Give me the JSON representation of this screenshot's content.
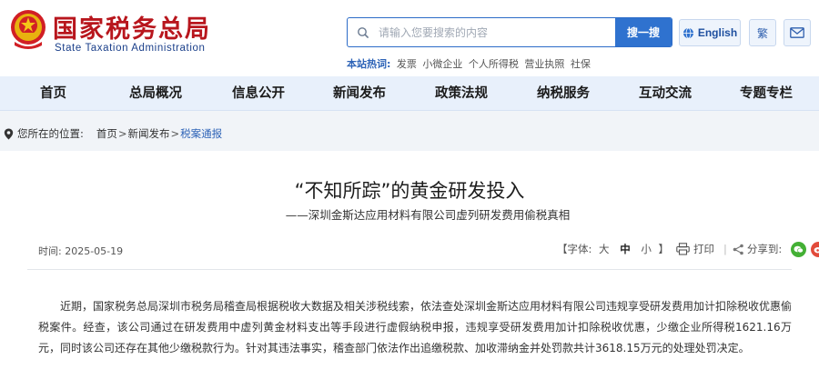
{
  "header": {
    "site_title": "国家税务总局",
    "site_subtitle": "State Taxation Administration",
    "search": {
      "placeholder": "请输入您要搜索的内容",
      "button_label": "搜一搜"
    },
    "lang_label": "English",
    "trad_label": "繁",
    "mail_icon": "mail-icon",
    "hot_search": {
      "label": "本站热词:",
      "keywords": [
        "发票",
        "小微企业",
        "个人所得税",
        "营业执照",
        "社保"
      ]
    },
    "colors": {
      "brand_red": "#b8161d",
      "accent_blue": "#2f72cf"
    }
  },
  "nav": {
    "items": [
      {
        "label": "首页"
      },
      {
        "label": "总局概况"
      },
      {
        "label": "信息公开"
      },
      {
        "label": "新闻发布"
      },
      {
        "label": "政策法规"
      },
      {
        "label": "纳税服务"
      },
      {
        "label": "互动交流"
      },
      {
        "label": "专题专栏"
      }
    ]
  },
  "breadcrumb": {
    "prefix": "您所在的位置:",
    "items": [
      "首页",
      "新闻发布",
      "税案通报"
    ],
    "separator": ">"
  },
  "article": {
    "title": "“不知所踪”的黄金研发投入",
    "subtitle": "——深圳金斯达应用材料有限公司虚列研发费用偷税真相",
    "time_label": "时间:",
    "time_value": "2025-05-19",
    "font_label": "【字体:",
    "font_large": "大",
    "font_medium": "中",
    "font_small": "小",
    "font_close": "】",
    "print_label": "打印",
    "share_label": "分享到:",
    "body": "近期，国家税务总局深圳市税务局稽查局根据税收大数据及相关涉税线索，依法查处深圳金斯达应用材料有限公司违规享受研发费用加计扣除税收优惠偷税案件。经查，该公司通过在研发费用中虚列黄金材料支出等手段进行虚假纳税申报，违规享受研发费用加计扣除税收优惠，少缴企业所得税1621.16万元，同时该公司还存在其他少缴税款行为。针对其违法事实，稽查部门依法作出追缴税款、加收滞纳金并处罚款共计3618.15万元的处理处罚决定。"
  }
}
